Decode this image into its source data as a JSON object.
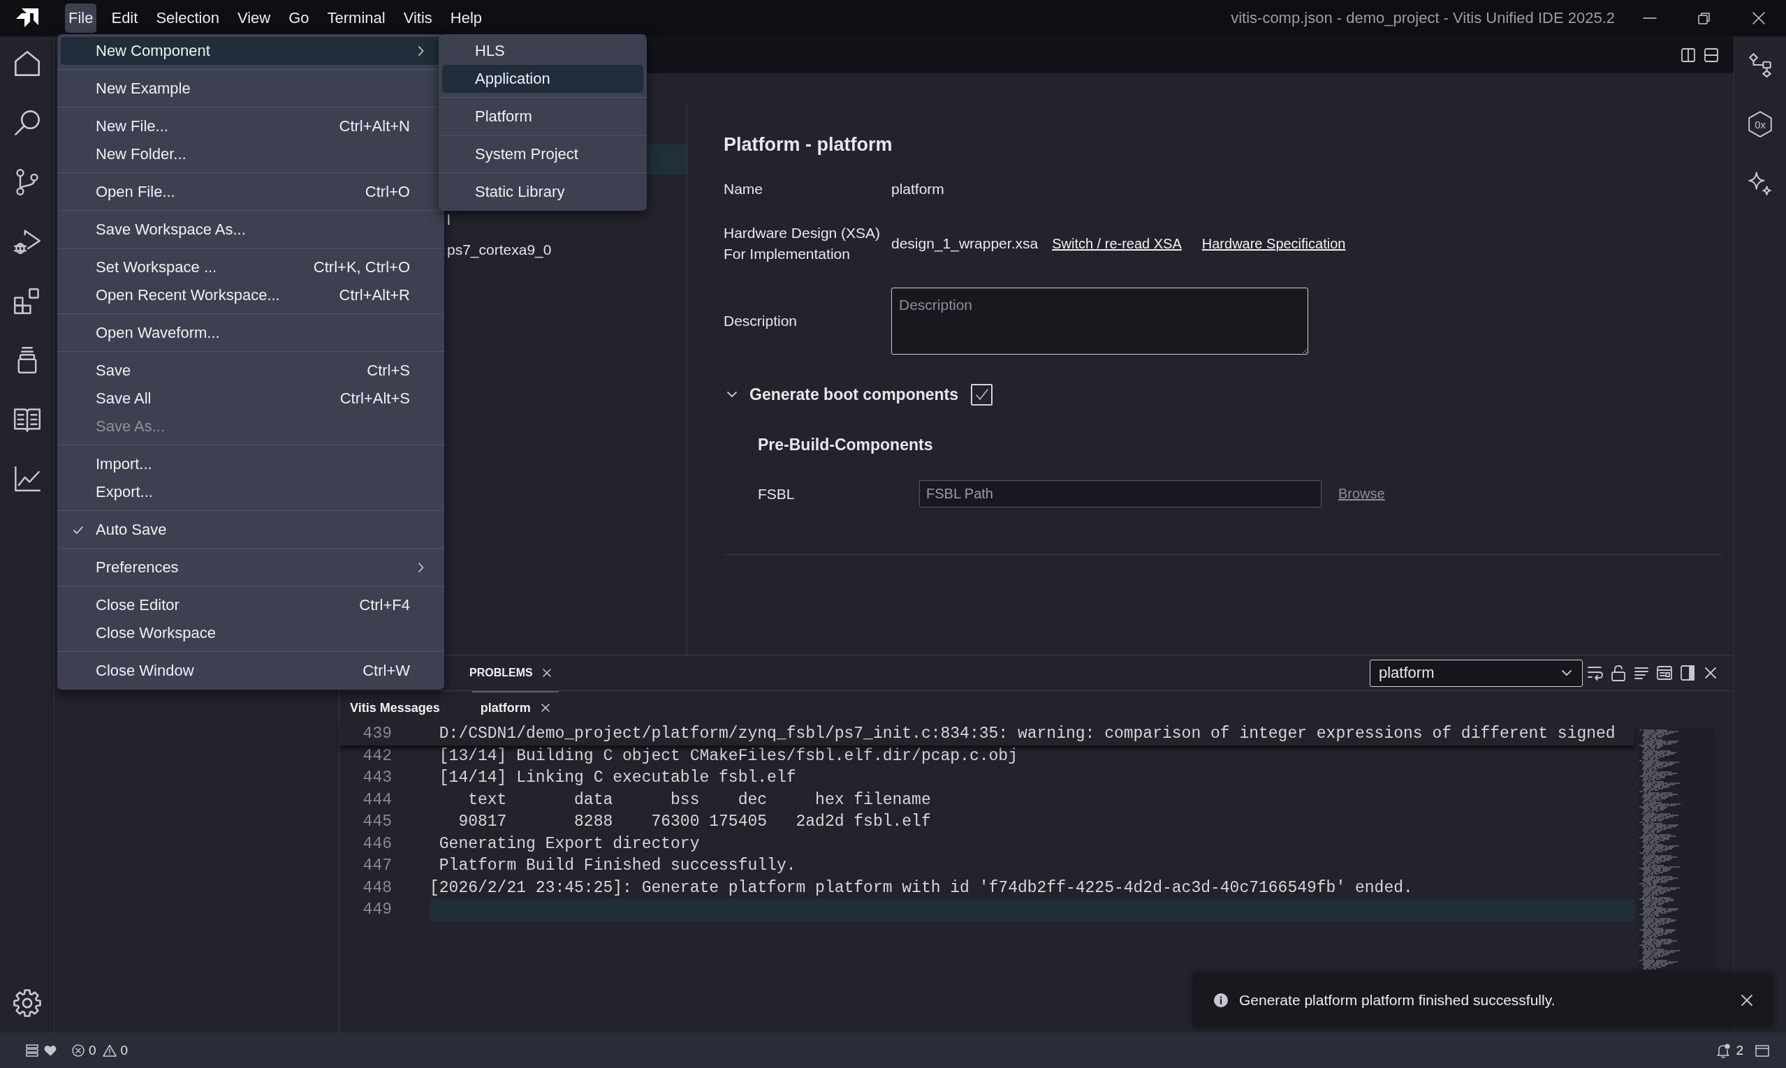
{
  "title_bar": {
    "menus": [
      {
        "label": "File",
        "selected": true
      },
      {
        "label": "Edit",
        "selected": false
      },
      {
        "label": "Selection",
        "selected": false
      },
      {
        "label": "View",
        "selected": false
      },
      {
        "label": "Go",
        "selected": false
      },
      {
        "label": "Terminal",
        "selected": false
      },
      {
        "label": "Vitis",
        "selected": false
      },
      {
        "label": "Help",
        "selected": false
      }
    ],
    "title": "vitis-comp.json - demo_project - Vitis Unified IDE 2025.2"
  },
  "file_menu": {
    "groups": [
      [
        {
          "label": "New Component",
          "kind": "submenu",
          "selected": true,
          "checked": false,
          "disabled": false
        }
      ],
      [
        {
          "label": "New Example",
          "kind": "command",
          "selected": false,
          "checked": false,
          "disabled": false
        }
      ],
      [
        {
          "label": "New File...",
          "shortcut": "Ctrl+Alt+N",
          "kind": "command",
          "selected": false,
          "checked": false,
          "disabled": false
        },
        {
          "label": "New Folder...",
          "kind": "command",
          "selected": false,
          "checked": false,
          "disabled": false
        }
      ],
      [
        {
          "label": "Open File...",
          "shortcut": "Ctrl+O",
          "kind": "command",
          "selected": false,
          "checked": false,
          "disabled": false
        }
      ],
      [
        {
          "label": "Save Workspace As...",
          "kind": "command",
          "selected": false,
          "checked": false,
          "disabled": false
        }
      ],
      [
        {
          "label": "Set Workspace ...",
          "shortcut": "Ctrl+K, Ctrl+O",
          "kind": "command",
          "selected": false,
          "checked": false,
          "disabled": false
        },
        {
          "label": "Open Recent Workspace...",
          "shortcut": "Ctrl+Alt+R",
          "kind": "command",
          "selected": false,
          "checked": false,
          "disabled": false
        }
      ],
      [
        {
          "label": "Open Waveform...",
          "kind": "command",
          "selected": false,
          "checked": false,
          "disabled": false
        }
      ],
      [
        {
          "label": "Save",
          "shortcut": "Ctrl+S",
          "kind": "command",
          "selected": false,
          "checked": false,
          "disabled": false
        },
        {
          "label": "Save All",
          "shortcut": "Ctrl+Alt+S",
          "kind": "command",
          "selected": false,
          "checked": false,
          "disabled": false
        },
        {
          "label": "Save As...",
          "kind": "command",
          "selected": false,
          "checked": false,
          "disabled": true
        }
      ],
      [
        {
          "label": "Import...",
          "kind": "command",
          "selected": false,
          "checked": false,
          "disabled": false
        },
        {
          "label": "Export...",
          "kind": "command",
          "selected": false,
          "checked": false,
          "disabled": false
        }
      ],
      [
        {
          "label": "Auto Save",
          "kind": "command",
          "selected": false,
          "checked": true,
          "disabled": false
        }
      ],
      [
        {
          "label": "Preferences",
          "kind": "submenu",
          "selected": false,
          "checked": false,
          "disabled": false
        }
      ],
      [
        {
          "label": "Close Editor",
          "shortcut": "Ctrl+F4",
          "kind": "command",
          "selected": false,
          "checked": false,
          "disabled": false
        },
        {
          "label": "Close Workspace",
          "kind": "command",
          "selected": false,
          "checked": false,
          "disabled": false
        }
      ],
      [
        {
          "label": "Close Window",
          "shortcut": "Ctrl+W",
          "kind": "command",
          "selected": false,
          "checked": false,
          "disabled": false
        }
      ]
    ]
  },
  "new_component_submenu": {
    "groups": [
      [
        {
          "label": "HLS",
          "selected": false
        },
        {
          "label": "Application",
          "selected": true
        }
      ],
      [
        {
          "label": "Platform",
          "selected": false
        }
      ],
      [
        {
          "label": "System Project",
          "selected": false
        }
      ],
      [
        {
          "label": "Static Library",
          "selected": false
        }
      ]
    ]
  },
  "editor": {
    "tree": {
      "rows": [
        {
          "selected": true
        },
        {
          "label": "l",
          "selected": false
        },
        {
          "label": "ps7_cortexa9_0",
          "selected": false
        }
      ]
    },
    "form": {
      "title": "Platform - platform",
      "fields": [
        {
          "kind": "value",
          "label_lines": [
            "Name"
          ],
          "value": "platform"
        },
        {
          "kind": "file",
          "label_lines": [
            "Hardware Design (XSA)",
            "For Implementation"
          ],
          "value": "design_1_wrapper.xsa",
          "links": [
            "Switch / re-read XSA",
            "Hardware Specification"
          ]
        },
        {
          "kind": "textarea",
          "label_lines": [
            "Description"
          ],
          "placeholder": "Description"
        }
      ],
      "boot": {
        "label": "Generate boot components",
        "expanded": true,
        "checked": true,
        "subtitle": "Pre-Build-Components",
        "fields": [
          {
            "label": "FSBL",
            "placeholder": "FSBL Path",
            "link": "Browse"
          }
        ]
      }
    }
  },
  "panel": {
    "tabs": [
      {
        "label": "PROBLEMS",
        "closable": true
      }
    ],
    "filter": {
      "value": "platform"
    },
    "output_tabs": [
      {
        "label": "Vitis Messages",
        "selected": false,
        "closable": false
      },
      {
        "label": "platform",
        "selected": true,
        "closable": true
      }
    ],
    "sticky_line": {
      "number": "439",
      "text": " D:/CSDN1/demo_project/platform/zynq_fsbl/ps7_init.c:834:35: warning: comparison of integer expressions of different signed"
    },
    "lines": [
      {
        "number": "442",
        "text": " [13/14] Building C object CMakeFiles/fsbl.elf.dir/pcap.c.obj",
        "current": false
      },
      {
        "number": "443",
        "text": " [14/14] Linking C executable fsbl.elf",
        "current": false
      },
      {
        "number": "444",
        "text": "    text       data      bss    dec     hex filename",
        "current": false
      },
      {
        "number": "445",
        "text": "   90817       8288    76300 175405   2ad2d fsbl.elf",
        "current": false
      },
      {
        "number": "446",
        "text": " Generating Export directory",
        "current": false
      },
      {
        "number": "447",
        "text": " Platform Build Finished successfully.",
        "current": false
      },
      {
        "number": "448",
        "text": "[2026/2/21 23:45:25]: Generate platform platform with id 'f74db2ff-4225-4d2d-ac3d-40c7166549fb' ended.",
        "current": false
      },
      {
        "number": "449",
        "current": true
      }
    ]
  },
  "notification": {
    "message": "Generate platform platform finished successfully."
  },
  "status_bar": {
    "errors": "0",
    "warnings": "0",
    "notifications": "2"
  },
  "secondary_bar": {
    "hex_icon_text": "0x"
  }
}
